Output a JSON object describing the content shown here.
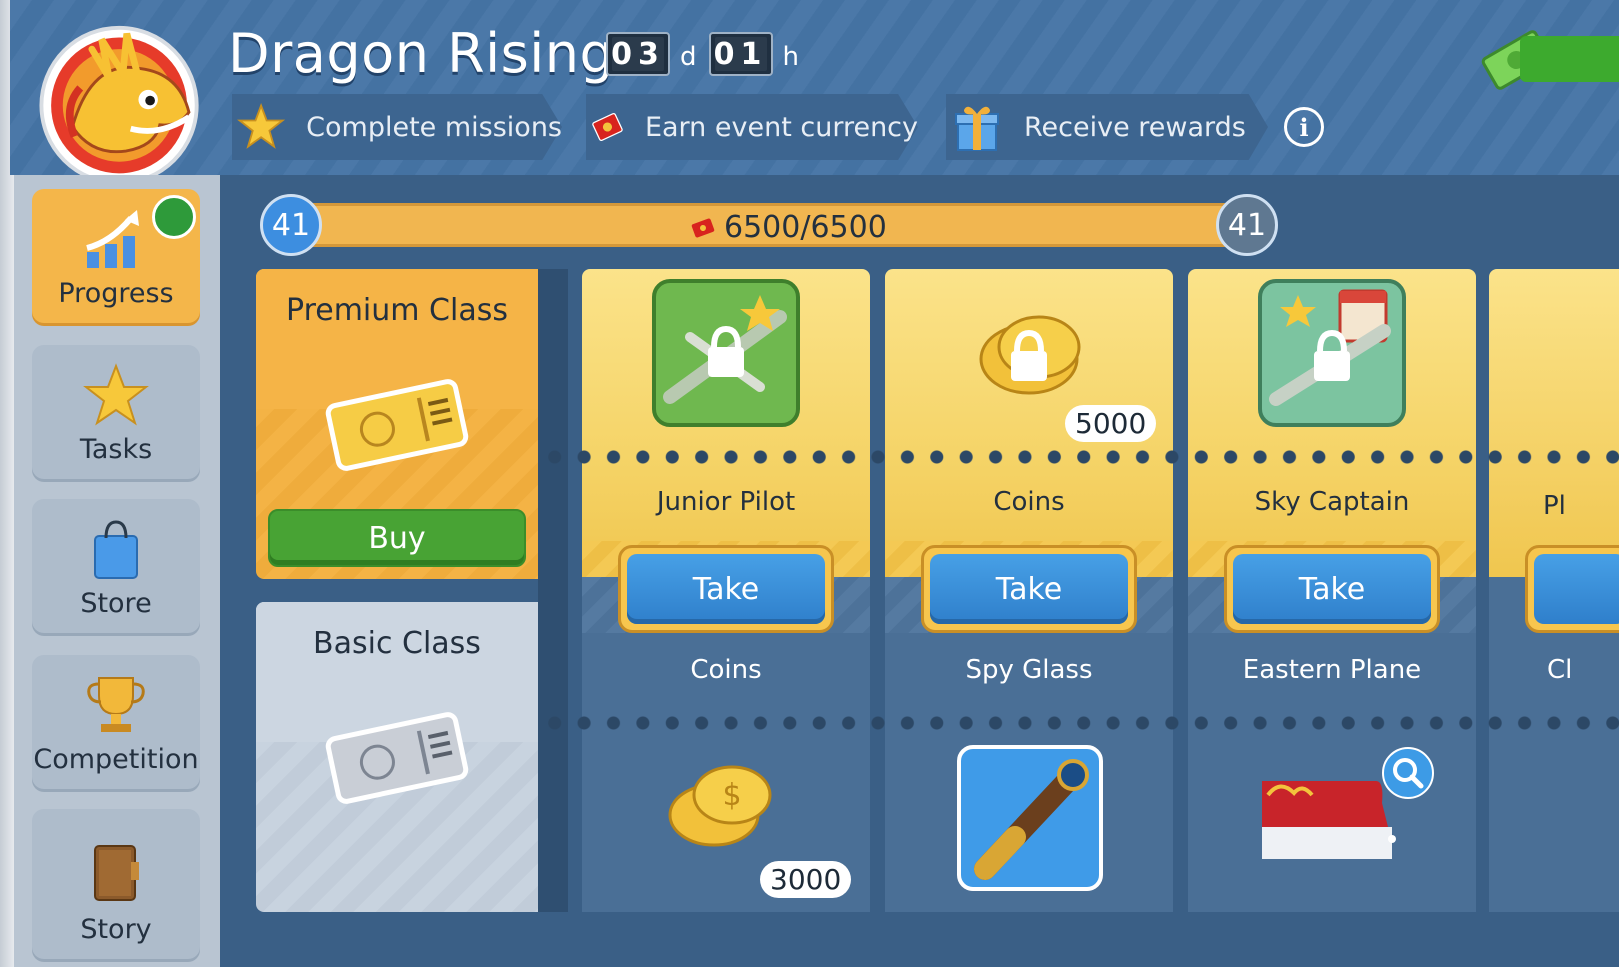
{
  "header": {
    "title": "Dragon Rising",
    "timer": {
      "days": "03",
      "days_unit": "d",
      "hours": "01",
      "hours_unit": "h"
    },
    "steps": [
      {
        "label": "Complete missions",
        "icon": "star-icon"
      },
      {
        "label": "Earn event currency",
        "icon": "red-envelope-icon"
      },
      {
        "label": "Receive rewards",
        "icon": "gift-icon"
      }
    ],
    "info_icon": "info-icon",
    "currency_icon": "cash-icon"
  },
  "sidebar": {
    "items": [
      {
        "label": "Progress",
        "icon": "progress-chart-icon",
        "active": true,
        "badge": "gift-badge"
      },
      {
        "label": "Tasks",
        "icon": "star-icon"
      },
      {
        "label": "Store",
        "icon": "shopping-bag-icon"
      },
      {
        "label": "Competition",
        "icon": "trophy-icon"
      },
      {
        "label": "Story",
        "icon": "book-icon"
      }
    ]
  },
  "progress": {
    "level_current": "41",
    "level_next": "41",
    "points_text": "6500/6500",
    "fill_fraction": 1.0
  },
  "classes": {
    "premium": {
      "title": "Premium Class",
      "buy_label": "Buy"
    },
    "basic": {
      "title": "Basic Class"
    }
  },
  "rewards": [
    {
      "premium_name": "Junior Pilot",
      "premium_icon": "locked-plane-avatar-icon",
      "take_label": "Take",
      "basic_name": "Coins",
      "basic_icon": "coins-icon",
      "basic_amount": "3000"
    },
    {
      "premium_name": "Coins",
      "premium_icon": "locked-coins-icon",
      "premium_amount": "5000",
      "take_label": "Take",
      "basic_name": "Spy Glass",
      "basic_icon": "spyglass-icon"
    },
    {
      "premium_name": "Sky Captain",
      "premium_icon": "locked-plane-calendar-icon",
      "take_label": "Take",
      "basic_name": "Eastern Plane",
      "basic_icon": "plane-livery-icon"
    }
  ],
  "partial_column": {
    "premium_name": "Pl",
    "basic_name": "Cl"
  },
  "colors": {
    "header_blue": "#4472a2",
    "panel_blue": "#3a5f86",
    "gold": "#f5b447",
    "take_blue": "#2f7fcb",
    "buy_green": "#48a334"
  }
}
